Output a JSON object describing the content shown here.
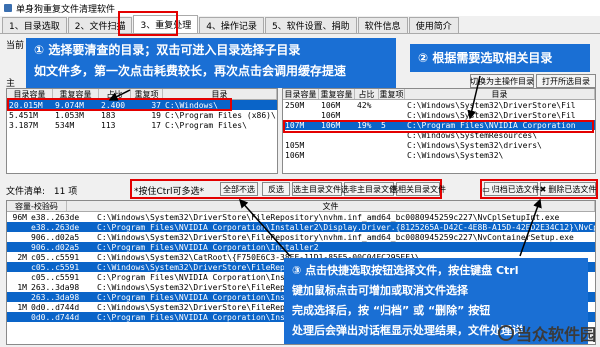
{
  "window": {
    "title": "单身狗重复文件清理软件"
  },
  "tabs": [
    {
      "label": "1、目录选取"
    },
    {
      "label": "2、文件扫描"
    },
    {
      "label": "3、重复处理"
    },
    {
      "label": "4、操作记录"
    },
    {
      "label": "5、软件设置、捐助"
    },
    {
      "label": "软件信息"
    },
    {
      "label": "使用简介"
    }
  ],
  "labels": {
    "current": "当前",
    "main_dir": "主",
    "file_list": "文件清单:",
    "file_count": "11 项",
    "ctrl_hint": "*按住Ctrl可多选*"
  },
  "left_list": {
    "columns": [
      "目录容量",
      "重复容量",
      "占比",
      "重复项",
      "目录"
    ],
    "rows": [
      {
        "size": "20.015M",
        "dup": "9.074M",
        "pct": "2.400",
        "count": "37",
        "path": "C:\\Windows\\"
      },
      {
        "size": "5.451M",
        "dup": "1.053M",
        "pct": "183",
        "count": "19",
        "path": "C:\\Program Files (x86)\\"
      },
      {
        "size": "3.187M",
        "dup": "534M",
        "pct": "113",
        "count": "17",
        "path": "C:\\Program Files\\"
      }
    ]
  },
  "right_list": {
    "columns": [
      "目录容量",
      "重复容量",
      "占比",
      "重复项",
      "目录"
    ],
    "buttons": {
      "switch_main": "切换为主操作目录",
      "open_dir": "打开所选目录"
    },
    "rows": [
      {
        "size": "250M",
        "dup": "106M",
        "pct": "42%",
        "count": "",
        "path": "C:\\Windows\\System32\\DriverStore\\Fil"
      },
      {
        "size": "",
        "dup": "106M",
        "pct": "",
        "count": "",
        "path": "C:\\Windows\\System32\\DriverStore\\Fil"
      },
      {
        "size": "107M",
        "dup": "106M",
        "pct": "19%",
        "count": "5",
        "path": "C:\\Program Files\\NVIDIA Corporation"
      },
      {
        "size": "",
        "dup": "",
        "pct": "",
        "count": "",
        "path": "C:\\Windows\\SystemResources\\"
      },
      {
        "size": "105M",
        "dup": "",
        "pct": "",
        "count": "",
        "path": "C:\\Windows\\System32\\drivers\\"
      },
      {
        "size": "106M",
        "dup": "",
        "pct": "",
        "count": "",
        "path": "C:\\Windows\\System32\\"
      }
    ]
  },
  "file_buttons": {
    "select_all_none": "全部不选",
    "invert": "反选",
    "select_main_dir_files": "选主目录文件",
    "select_sub_main_dir_files": "选非主目录文件",
    "select_related_dir_files": "选相关目录文件",
    "archive_selected": "归档已选文件",
    "delete_selected": "删除已选文件"
  },
  "file_list": {
    "columns": [
      "容量-校验码",
      "文件"
    ],
    "rows": [
      {
        "size": "96M",
        "hash": "e38..263de",
        "path": "C:\\Windows\\System32\\DriverStore\\FileRepository\\nvhm.inf_amd64_bc0080945259c227\\NvCplSetupInt.exe",
        "sel": false
      },
      {
        "size": "",
        "hash": "e38..263de",
        "path": "C:\\Program Files\\NVIDIA Corporation\\Installer2\\Display.Driver.{8125265A-D42C-4E8B-A15D-42ED2E34C12}\\NvCplSetupInt",
        "sel": true
      },
      {
        "size": "",
        "hash": "906..d02a5",
        "path": "C:\\Windows\\System32\\DriverStore\\FileRepository\\nvhm.inf_amd64_bc0080945259c227\\NvContainerSetup.exe",
        "sel": false
      },
      {
        "size": "",
        "hash": "906..d02a5",
        "path": "C:\\Program Files\\NVIDIA Corporation\\Installer2",
        "sel": true
      },
      {
        "size": "2M",
        "hash": "c05..c5591",
        "path": "C:\\Windows\\System32\\CatRoot\\{F750E6C3-38EE-11D1-85E5-00C04FC295EE}\\",
        "sel": false
      },
      {
        "size": "",
        "hash": "c05..c5591",
        "path": "C:\\Windows\\System32\\DriverStore\\FileRepository\\nvhm.inf_amd64",
        "sel": true
      },
      {
        "size": "",
        "hash": "c05..c5591",
        "path": "C:\\Program Files\\NVIDIA Corporation\\Install",
        "sel": false
      },
      {
        "size": "1M",
        "hash": "263..3da98",
        "path": "C:\\Windows\\System32\\DriverStore\\FileRepository\\nvhm.inf_amd64",
        "sel": false
      },
      {
        "size": "",
        "hash": "263..3da98",
        "path": "C:\\Program Files\\NVIDIA Corporation\\Install",
        "sel": true
      },
      {
        "size": "1M",
        "hash": "0d0..d744d",
        "path": "C:\\Windows\\System32\\DriverStore\\FileRepository\\nvhm.inf_amd64",
        "sel": false
      },
      {
        "size": "",
        "hash": "0d0..d744d",
        "path": "C:\\Program Files\\NVIDIA Corporation\\Install",
        "sel": true
      }
    ]
  },
  "callouts": {
    "one_line1": "① 选择要清查的目录；双击可进入目录选择子目录",
    "one_line2": "如文件多，第一次点击耗费较长，再次点击会调用缓存提速",
    "two": "② 根据需要选取相关目录",
    "three_line1": "③ 点击快捷选取按钮选择文件，按住键盘 Ctrl",
    "three_line2": "键加鼠标点击可增加或取消文件选择",
    "three_line3": "完成选择后，按 “归档” 或 “删除” 按钮",
    "three_line4": "处理后会弹出对话框显示处理结果，文件处理详"
  },
  "watermark": {
    "text": "当众软件园"
  },
  "colors": {
    "accent_blue": "#1a6fd4",
    "select_blue": "#0a64c8",
    "highlight_red": "#e30000"
  }
}
